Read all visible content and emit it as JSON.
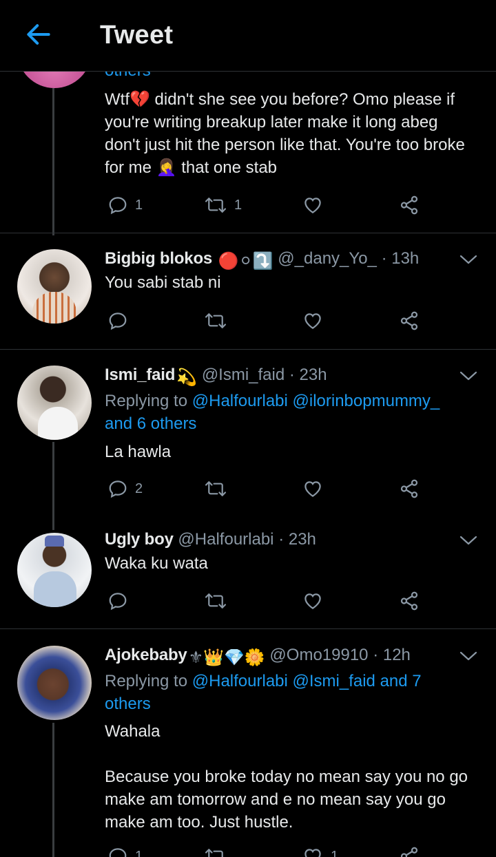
{
  "header": {
    "title": "Tweet",
    "back_icon": "arrow-left-icon"
  },
  "colors": {
    "accent": "#1d9bf0",
    "background": "#000000",
    "muted": "#8b98a5",
    "text": "#e7e9ea"
  },
  "tweets": [
    {
      "partial_text": "others",
      "text": "Wtf💔 didn't she see you before? Omo please if\nyou're writing breakup later make it long abeg\ndon't just hit the person like that. You're too broke\nfor me 🤦‍♀️ that one stab",
      "replies": "1",
      "retweets": "1",
      "likes": ""
    },
    {
      "display_name": "Bigbig blokos",
      "emojis": "🔴⚪⤵️",
      "handle": "@_dany_Yo_",
      "time": "· 13h",
      "text": "You sabi stab ni",
      "replies": "",
      "retweets": "",
      "likes": ""
    },
    {
      "display_name": "Ismi_faid",
      "emojis": "💫",
      "handle": "@Ismi_faid",
      "time": "· 23h",
      "replying_prefix": "Replying to ",
      "replying_mentions": "@Halfourlabi @ilorinbopmummy_\nand 6 others",
      "text": "La hawla",
      "replies": "2",
      "retweets": "",
      "likes": ""
    },
    {
      "display_name": "Ugly boy",
      "handle": "@Halfourlabi",
      "time": "· 23h",
      "text": "Waka ku wata",
      "replies": "",
      "retweets": "",
      "likes": ""
    },
    {
      "display_name": "Ajokebaby",
      "emojis": "⚜👑💎🌼",
      "handle": "@Omo19910",
      "time": "· 12h",
      "replying_prefix": "Replying to ",
      "replying_mentions": "@Halfourlabi @Ismi_faid and 7\nothers",
      "text": "Wahala\n\nBecause you broke today no mean say you no go\nmake am tomorrow and e no mean say you go\nmake am too. Just hustle.",
      "replies": "1",
      "retweets": "",
      "likes": "1"
    }
  ]
}
